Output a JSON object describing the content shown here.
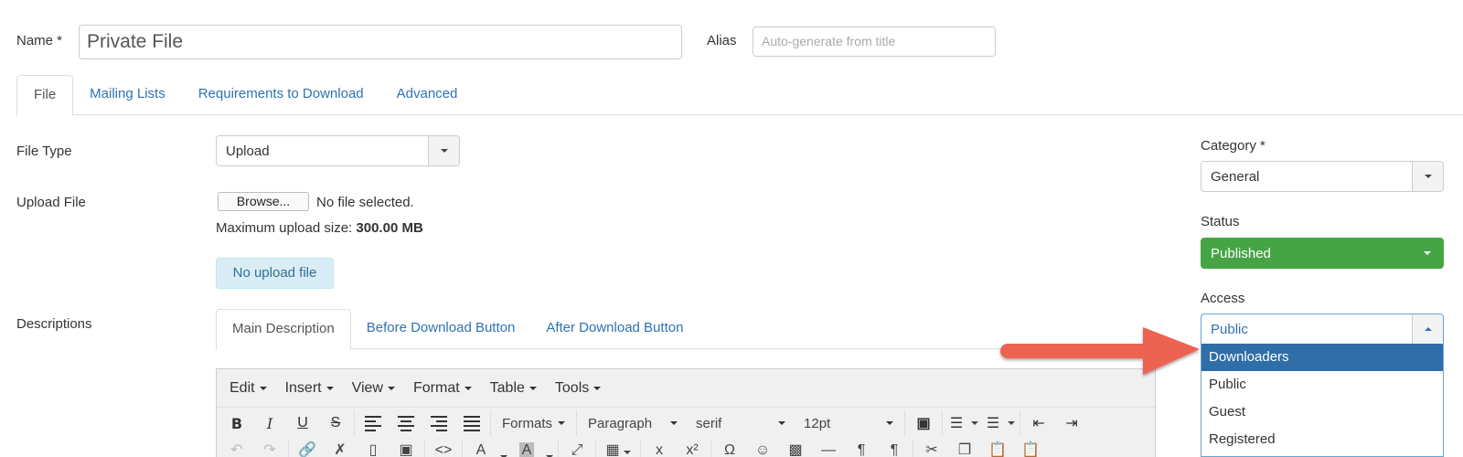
{
  "name_field": {
    "label": "Name *",
    "value": "Private File"
  },
  "alias_field": {
    "label": "Alias",
    "placeholder": "Auto-generate from title"
  },
  "main_tabs": [
    {
      "label": "File",
      "active": true
    },
    {
      "label": "Mailing Lists",
      "active": false
    },
    {
      "label": "Requirements to Download",
      "active": false
    },
    {
      "label": "Advanced",
      "active": false
    }
  ],
  "file_type": {
    "label": "File Type",
    "value": "Upload"
  },
  "upload_file": {
    "label": "Upload File",
    "browse_label": "Browse...",
    "no_file_text": "No file selected.",
    "max_size_prefix": "Maximum upload size:",
    "max_size_value": "300.00 MB",
    "no_upload_badge": "No upload file"
  },
  "descriptions": {
    "label": "Descriptions",
    "tabs": [
      {
        "label": "Main Description",
        "active": true
      },
      {
        "label": "Before Download Button",
        "active": false
      },
      {
        "label": "After Download Button",
        "active": false
      }
    ]
  },
  "editor": {
    "menus": [
      "Edit",
      "Insert",
      "View",
      "Format",
      "Table",
      "Tools"
    ],
    "formats_label": "Formats",
    "block_format": "Paragraph",
    "font_family": "serif",
    "font_size": "12pt",
    "toolbar_row1_icons": [
      "bold-icon",
      "italic-icon",
      "underline-icon",
      "strikethrough-icon",
      "align-left-icon",
      "align-center-icon",
      "align-right-icon",
      "align-justify-icon",
      "find-replace-icon",
      "bullet-list-icon",
      "numbered-list-icon",
      "outdent-icon",
      "indent-icon"
    ],
    "toolbar_row2_icons": [
      "undo-icon",
      "redo-icon",
      "link-icon",
      "unlink-icon",
      "anchor-icon",
      "image-icon",
      "code-icon",
      "text-color-icon",
      "background-color-icon",
      "fullscreen-icon",
      "table-icon",
      "subscript-icon",
      "superscript-icon",
      "special-char-icon",
      "emoticons-icon",
      "media-icon",
      "horizontal-rule-icon",
      "ltr-icon",
      "rtl-icon",
      "cut-icon",
      "copy-icon",
      "paste-icon",
      "paste-text-icon"
    ]
  },
  "sidebar": {
    "category": {
      "label": "Category *",
      "value": "General"
    },
    "status": {
      "label": "Status",
      "value": "Published",
      "color": "#45a545"
    },
    "access": {
      "label": "Access",
      "value": "Public",
      "open": true,
      "options": [
        "Downloaders",
        "Public",
        "Guest",
        "Registered"
      ],
      "highlighted": "Downloaders",
      "highlight_color": "#2f6ea8"
    }
  },
  "annotation": {
    "type": "arrow",
    "points_to": "Downloaders",
    "color": "#ec6351"
  },
  "colors": {
    "link": "#2f72b2",
    "info_bg": "#d9edf7"
  }
}
